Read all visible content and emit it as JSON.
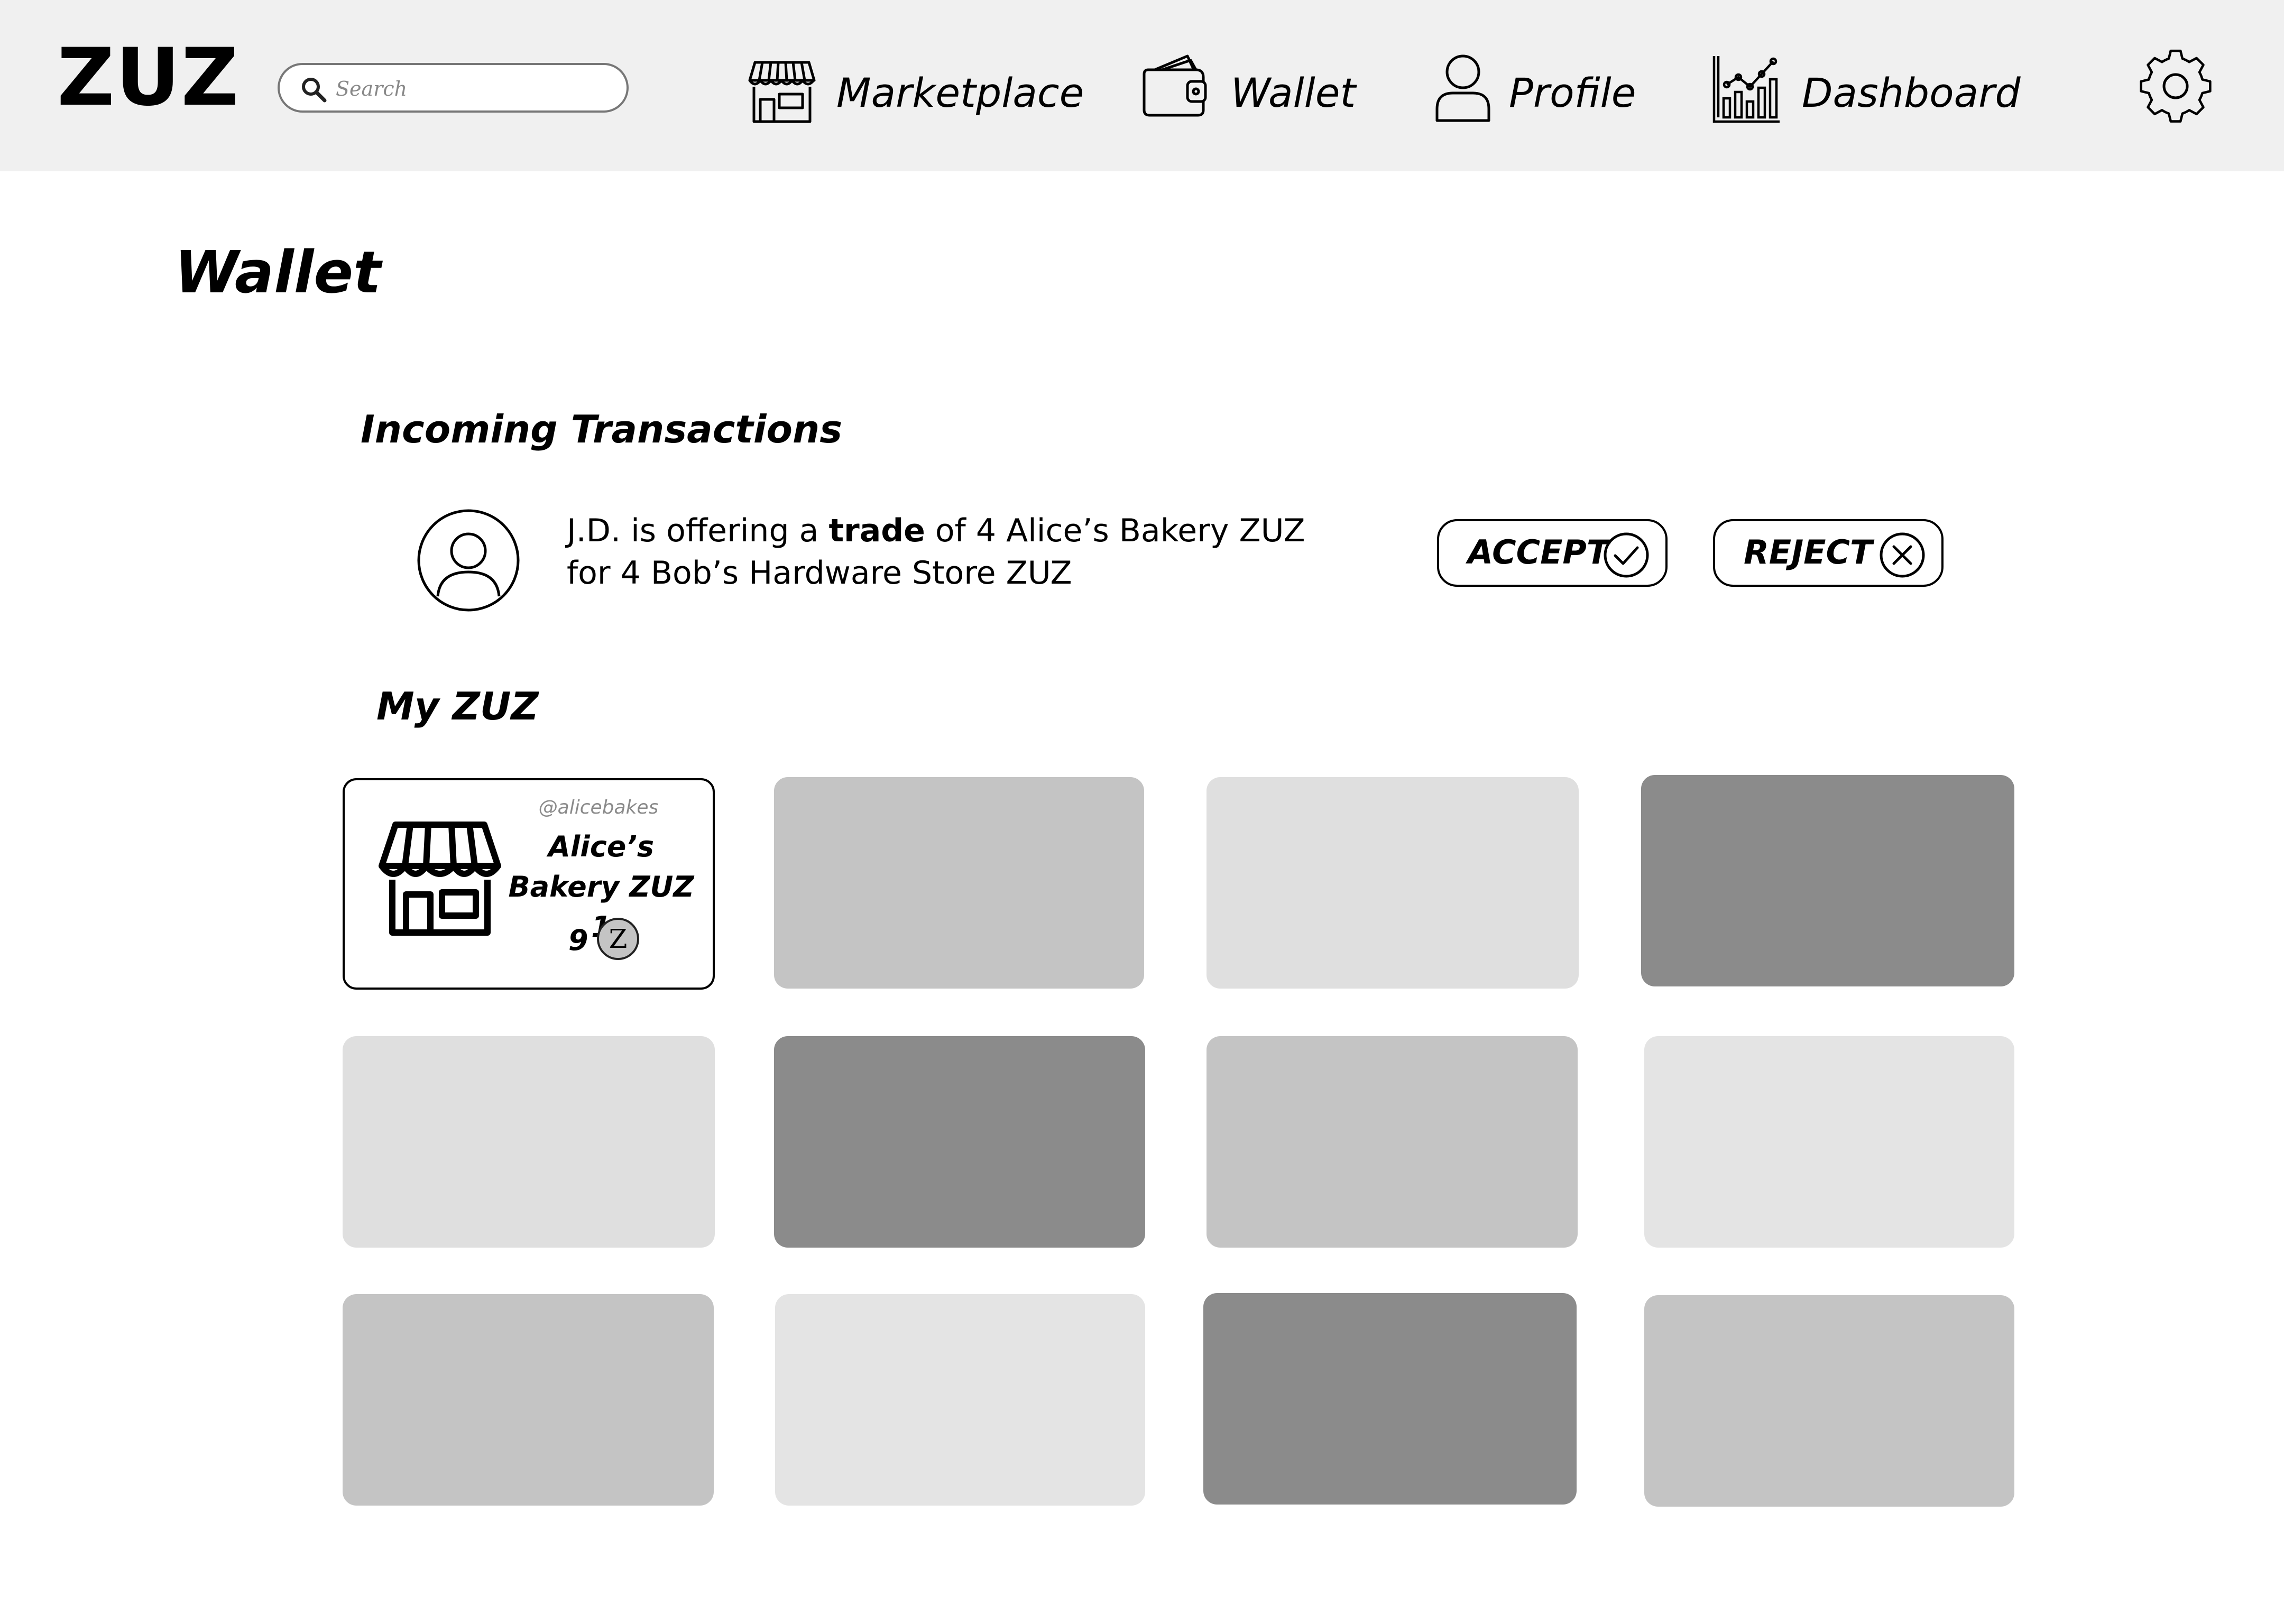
{
  "app": {
    "logo": "ZUZ"
  },
  "search": {
    "placeholder": "Search"
  },
  "nav": {
    "marketplace": "Marketplace",
    "wallet": "Wallet",
    "profile": "Profile",
    "dashboard": "Dashboard"
  },
  "page": {
    "title": "Wallet"
  },
  "incoming": {
    "title": "Incoming Transactions",
    "transactions": [
      {
        "prefix": "J.D. is offering a ",
        "emphasis": "trade",
        "suffix": " of 4 Alice’s Bakery ZUZ for 4 Bob’s Hardware Store ZUZ",
        "accept_label": "ACCEPT",
        "reject_label": "REJECT"
      }
    ]
  },
  "my_zuz": {
    "title": "My ZUZ",
    "cards": [
      {
        "handle": "@alicebakes",
        "name": "Alice’s Bakery ZUZ 1",
        "count": "9",
        "coin": "Z",
        "icon": "store-icon"
      }
    ],
    "placeholder_shades": [
      "#c4c4c4",
      "#dfdfdf",
      "#8b8b8b",
      "#dfdfdf",
      "#8b8b8b",
      "#c4c4c4",
      "#e4e4e4",
      "#c4c4c4",
      "#e4e4e4",
      "#8b8b8b",
      "#c4c4c4"
    ]
  },
  "colors": {
    "header_bg": "#f0f0f0",
    "coin_fill": "#c4c4c4"
  }
}
